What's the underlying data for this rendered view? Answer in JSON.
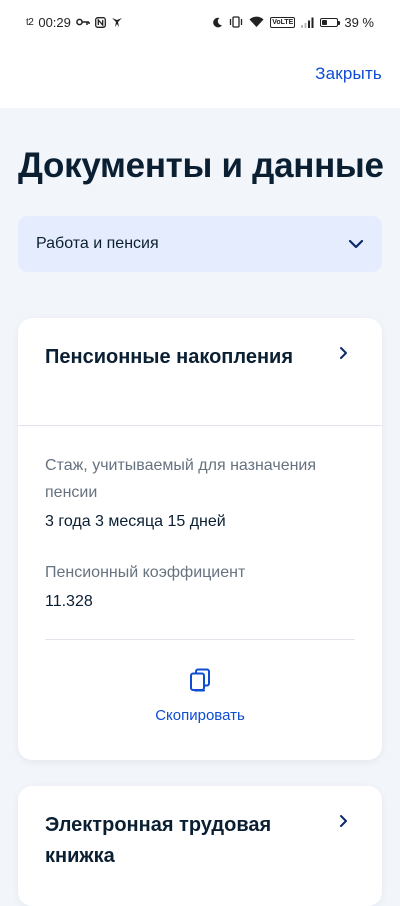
{
  "status_bar": {
    "sim": "t2",
    "time": "00:29",
    "battery_percent": "39 %",
    "battery_level": 0.39,
    "icons": [
      "key-icon",
      "nfc-icon",
      "bird-icon",
      "moon-icon",
      "vibrate-icon",
      "wifi-icon",
      "volte-icon",
      "signal-icon",
      "battery-icon"
    ],
    "volte_label": "VoLTE"
  },
  "topbar": {
    "close_label": "Закрыть"
  },
  "page": {
    "title": "Документы и данные"
  },
  "category": {
    "selected": "Работа и пенсия",
    "icon": "chevron-down-icon"
  },
  "cards": [
    {
      "title": "Пенсионные накопления",
      "icon": "chevron-right-icon",
      "fields": [
        {
          "label": "Стаж, учитываемый для назначения пенсии",
          "value": "3 года 3 месяца 15 дней"
        },
        {
          "label": "Пенсионный коэффициент",
          "value": "11.328"
        }
      ],
      "action": {
        "label": "Скопировать",
        "icon": "copy-icon"
      }
    },
    {
      "title": "Электронная трудовая книжка",
      "icon": "chevron-right-icon"
    }
  ],
  "colors": {
    "accent": "#0d4cd3",
    "text": "#0b1f33",
    "secondary_text": "#66727f",
    "background": "#f2f5fa",
    "select_background": "#e4ecfd"
  }
}
